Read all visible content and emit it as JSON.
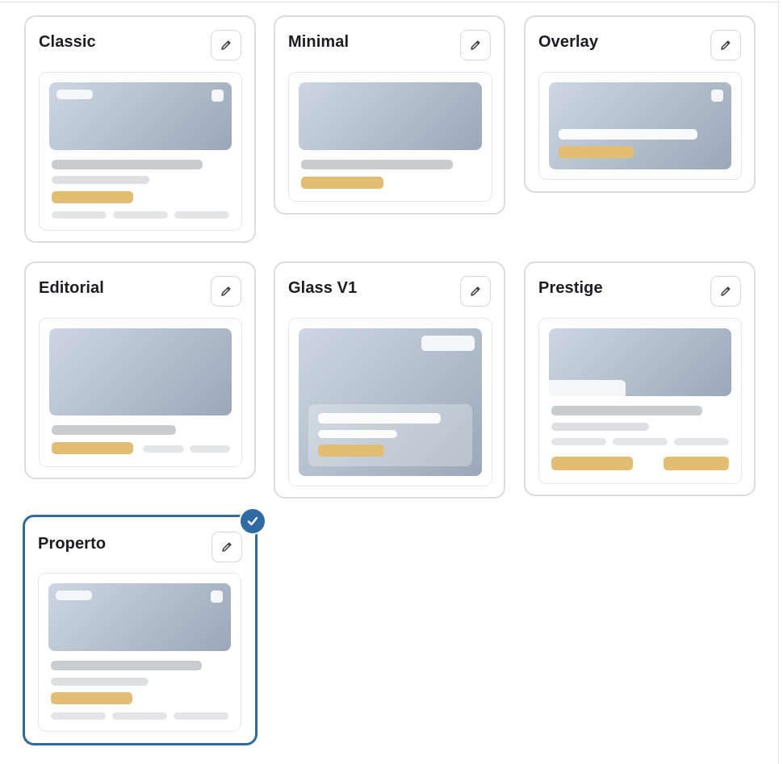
{
  "templates": [
    {
      "id": "classic",
      "title": "Classic",
      "selected": false
    },
    {
      "id": "minimal",
      "title": "Minimal",
      "selected": false
    },
    {
      "id": "overlay",
      "title": "Overlay",
      "selected": false
    },
    {
      "id": "editorial",
      "title": "Editorial",
      "selected": false
    },
    {
      "id": "glass-v1",
      "title": "Glass V1",
      "selected": false
    },
    {
      "id": "prestige",
      "title": "Prestige",
      "selected": false
    },
    {
      "id": "properto",
      "title": "Properto",
      "selected": true
    }
  ],
  "icons": {
    "edit": "pencil-icon",
    "selected": "checkmark-icon"
  },
  "colors": {
    "accent": "#2f6aa3",
    "card_border": "#dadcdf",
    "placeholder_gold": "#e2bd74",
    "placeholder_gray": "#c9cccf"
  }
}
